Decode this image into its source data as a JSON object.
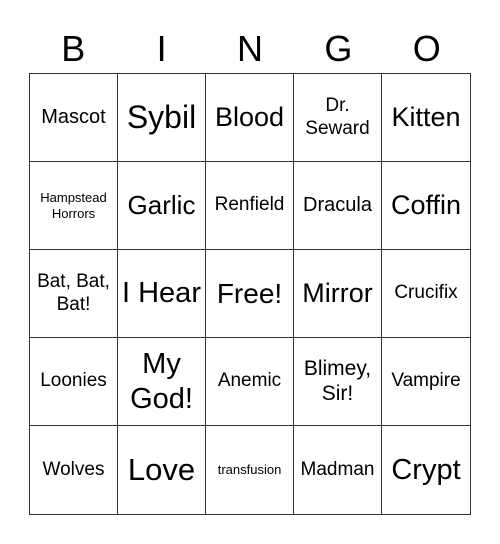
{
  "header": [
    "B",
    "I",
    "N",
    "G",
    "O"
  ],
  "cells": [
    "Mascot",
    "Sybil",
    "Blood",
    "Dr. Seward",
    "Kitten",
    "Hampstead Horrors",
    "Garlic",
    "Renfield",
    "Dracula",
    "Coffin",
    "Bat, Bat, Bat!",
    "I Hear",
    "Free!",
    "Mirror",
    "Crucifix",
    "Loonies",
    "My God!",
    "Anemic",
    "Blimey, Sir!",
    "Vampire",
    "Wolves",
    "Love",
    "transfusion",
    "Madman",
    "Crypt"
  ]
}
